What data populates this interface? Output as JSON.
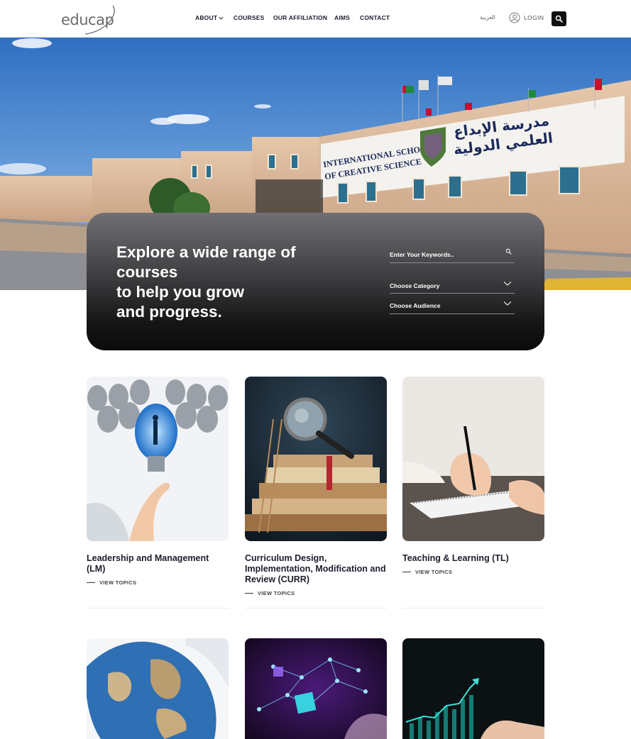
{
  "header": {
    "logo": "educap",
    "nav": [
      {
        "label": "ABOUT"
      },
      {
        "label": "COURSES"
      },
      {
        "label": "OUR AFFILIATION"
      },
      {
        "label": "AIMS"
      },
      {
        "label": "CONTACT"
      }
    ],
    "language": "العربية",
    "login": "LOGIN"
  },
  "hero": {
    "sign_english": "INTERNATIONAL SCHOOL OF CREATIVE SCIENCE",
    "sign_english_line1": "INTERNATIONAL SCHOOL",
    "sign_english_line2": "OF CREATIVE SCIENCE",
    "sign_arabic_line1": "مدرسة الإبداع",
    "sign_arabic_line2": "العلمي الدولية"
  },
  "search_panel": {
    "heading_lines": [
      "Explore a wide range of",
      "courses",
      "to help you grow",
      "and progress."
    ],
    "keyword_placeholder": "Enter Your Keywords..",
    "category_label": "Choose Category",
    "audience_label": "Choose Audience"
  },
  "courses": [
    {
      "title": "Leadership and Management (LM)",
      "link": "VIEW TOPICS",
      "image_icon": "lightbulb-icon"
    },
    {
      "title": "Curriculum Design, Implementation, Modification and Review (CURR)",
      "link": "VIEW TOPICS",
      "image_icon": "magnifier-books-icon"
    },
    {
      "title": "Teaching & Learning (TL)",
      "link": "VIEW TOPICS",
      "image_icon": "writing-hand-icon"
    },
    {
      "title": "",
      "image_icon": "globe-hands-icon"
    },
    {
      "title": "",
      "image_icon": "digital-network-icon"
    },
    {
      "title": "",
      "image_icon": "growth-chart-icon"
    }
  ],
  "colors": {
    "accent": "#111111",
    "panel_top": "#707074",
    "panel_bottom": "#0b0b0c",
    "text": "#1d1d2b"
  }
}
